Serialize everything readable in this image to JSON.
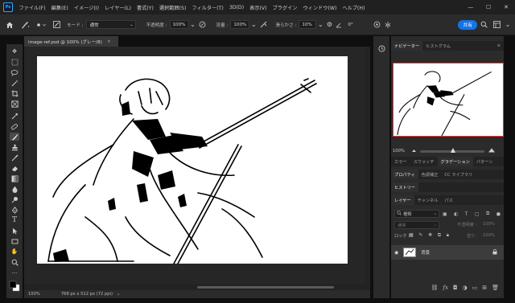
{
  "menubar": {
    "logo": "Ps",
    "items": [
      "ファイル(F)",
      "編集(E)",
      "イメージ(I)",
      "レイヤー(L)",
      "書式(Y)",
      "選択範囲(S)",
      "フィルター(T)",
      "3D(D)",
      "表示(V)",
      "プラグイン",
      "ウィンドウ(W)",
      "ヘルプ(H)"
    ],
    "window_buttons": [
      "—",
      "☐",
      "✕"
    ]
  },
  "optionsbar": {
    "mode_label": "モード :",
    "mode_value": "通常",
    "opacity_label": "不透明度 :",
    "opacity_value": "100%",
    "flow_label": "流量 :",
    "flow_value": "100%",
    "smoothing_label": "滑らかさ :",
    "smoothing_value": "10%",
    "angle_value": "0°",
    "share_label": "共有"
  },
  "document": {
    "tab_title": "image-ref.psd @ 100% (グレー/8)",
    "tab_close": "×",
    "status_zoom": "100%",
    "status_info": "768 px x 512 px (72 ppi)",
    "status_arrow": "›"
  },
  "panels": {
    "navigator_tabs": [
      "ナビゲーター",
      "ヒストグラム"
    ],
    "zoom_value": "100%",
    "color_tabs": [
      "カラー",
      "スウォッチ",
      "グラデーション",
      "パターン"
    ],
    "properties_tabs": [
      "プロパティ",
      "色調補正",
      "CC ライブラリ"
    ],
    "history_tab": "ヒストリー",
    "layer_tabs": [
      "レイヤー",
      "チャンネル",
      "パス"
    ],
    "layer_search_placeholder": "種類",
    "blend_mode": "通常",
    "opacity_label": "不透明度 :",
    "opacity_value": "100%",
    "lock_label": "ロック :",
    "fill_label": "塗り :",
    "fill_value": "100%",
    "layer_name": "背景"
  },
  "colors": {
    "accent": "#1473e6",
    "navigator_frame": "#e03a3a",
    "panel_bg": "#2b2b2b",
    "app_bg": "#1f1f1f"
  }
}
